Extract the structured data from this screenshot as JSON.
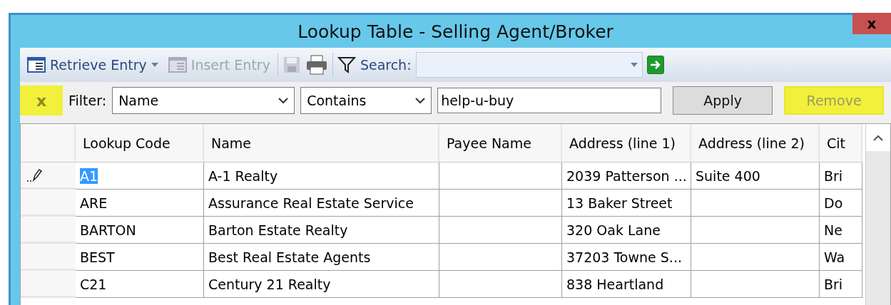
{
  "window": {
    "title": "Lookup Table - Selling Agent/Broker",
    "close": "x"
  },
  "toolbar": {
    "items": [
      {
        "kind": "button",
        "label": "Retrieve Entry",
        "disabled": false,
        "dropdown": true
      },
      {
        "kind": "button",
        "label": "Insert Entry",
        "disabled": true,
        "dropdown": false
      },
      {
        "kind": "icon",
        "disabled": true
      },
      {
        "kind": "icon",
        "disabled": false
      },
      {
        "kind": "icon",
        "disabled": false
      }
    ],
    "search": {
      "label": "Search:"
    }
  },
  "filter": {
    "clear": {
      "label": "x",
      "highlighted": true
    },
    "label": "Filter:",
    "field": "Name",
    "operator": "Contains",
    "value": "help-u-buy",
    "buttons": [
      {
        "label": "Apply",
        "disabled": false,
        "highlighted": false
      },
      {
        "label": "Remove",
        "disabled": true,
        "highlighted": true
      }
    ]
  },
  "table": {
    "columns": [
      "Lookup Code",
      "Name",
      "Payee Name",
      "Address (line 1)",
      "Address (line 2)",
      "Cit"
    ],
    "rows": [
      {
        "editing": true,
        "selected": true,
        "cells": [
          "A1",
          "A-1 Realty",
          "",
          "2039 Patterson ...",
          "Suite 400",
          "Bri"
        ]
      },
      {
        "editing": false,
        "selected": false,
        "cells": [
          "ARE",
          "Assurance Real Estate Service",
          "",
          "13 Baker Street",
          "",
          "Do"
        ]
      },
      {
        "editing": false,
        "selected": false,
        "cells": [
          "BARTON",
          "Barton Estate Realty",
          "",
          "320 Oak Lane",
          "",
          "Ne"
        ]
      },
      {
        "editing": false,
        "selected": false,
        "cells": [
          "BEST",
          "Best Real Estate Agents",
          "",
          "37203 Towne S...",
          "",
          "Wa"
        ]
      },
      {
        "editing": false,
        "selected": false,
        "cells": [
          "C21",
          "Century 21 Realty",
          "",
          "838 Heartland",
          "",
          "Bri"
        ]
      }
    ]
  }
}
